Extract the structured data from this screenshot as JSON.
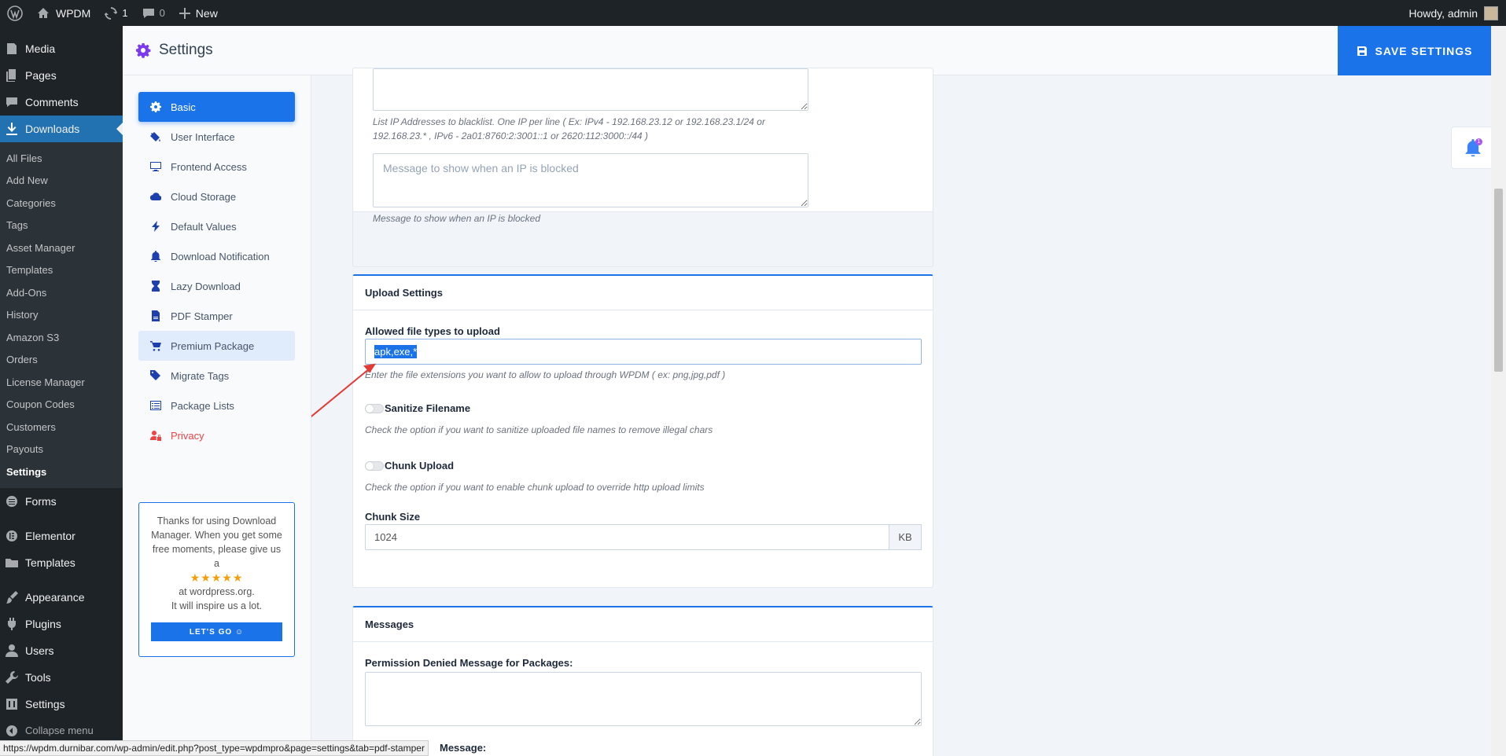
{
  "admin_bar": {
    "site_name": "WPDM",
    "updates_count": "1",
    "comments_count": "0",
    "new_label": "New",
    "howdy": "Howdy, admin"
  },
  "admin_menu": {
    "media": "Media",
    "pages": "Pages",
    "comments": "Comments",
    "downloads": "Downloads",
    "submenu": [
      "All Files",
      "Add New",
      "Categories",
      "Tags",
      "Asset Manager",
      "Templates",
      "Add-Ons",
      "History",
      "Amazon S3",
      "Orders",
      "License Manager",
      "Coupon Codes",
      "Customers",
      "Payouts",
      "Settings"
    ],
    "forms": "Forms",
    "elementor": "Elementor",
    "templates": "Templates",
    "appearance": "Appearance",
    "plugins": "Plugins",
    "users": "Users",
    "tools": "Tools",
    "settings": "Settings",
    "collapse": "Collapse menu"
  },
  "header": {
    "title": "Settings",
    "save_label": "SAVE SETTINGS"
  },
  "settings_nav": [
    "Basic",
    "User Interface",
    "Frontend Access",
    "Cloud Storage",
    "Default Values",
    "Download Notification",
    "Lazy Download",
    "PDF Stamper",
    "Premium Package",
    "Migrate Tags",
    "Package Lists",
    "Privacy"
  ],
  "promo": {
    "line1": "Thanks for using Download Manager. When you get some free moments, please give us a",
    "stars": "★★★★★",
    "line2": "at wordpress.org.",
    "line3": "It will inspire us a lot.",
    "button": "LET'S GO ☺"
  },
  "ip_block": {
    "hint": "List IP Addresses to blacklist. One IP per line ( Ex: IPv4 - 192.168.23.12 or 192.168.23.1/24 or 192.168.23.* , IPv6 - 2a01:8760:2:3001::1 or 2620:112:3000::/44 )",
    "message_placeholder": "Message to show when an IP is blocked",
    "message_hint": "Message to show when an IP is blocked"
  },
  "upload_settings": {
    "heading": "Upload Settings",
    "allowed_label": "Allowed file types to upload",
    "allowed_value": "apk,exe,*",
    "allowed_hint": "Enter the file extensions you want to allow to upload through WPDM ( ex: png,jpg,pdf )",
    "sanitize_label": "Sanitize Filename",
    "sanitize_hint": "Check the option if you want to sanitize uploaded file names to remove illegal chars",
    "chunk_label": "Chunk Upload",
    "chunk_hint": "Check the option if you want to enable chunk upload to override http upload limits",
    "chunk_size_label": "Chunk Size",
    "chunk_size_value": "1024",
    "chunk_size_unit": "KB"
  },
  "messages": {
    "heading": "Messages",
    "permission_label": "Permission Denied Message for Packages:",
    "next_label_partial": "Message:"
  },
  "notification_count": "1",
  "status_url": "https://wpdm.durnibar.com/wp-admin/edit.php?post_type=wpdmpro&page=settings&tab=pdf-stamper"
}
